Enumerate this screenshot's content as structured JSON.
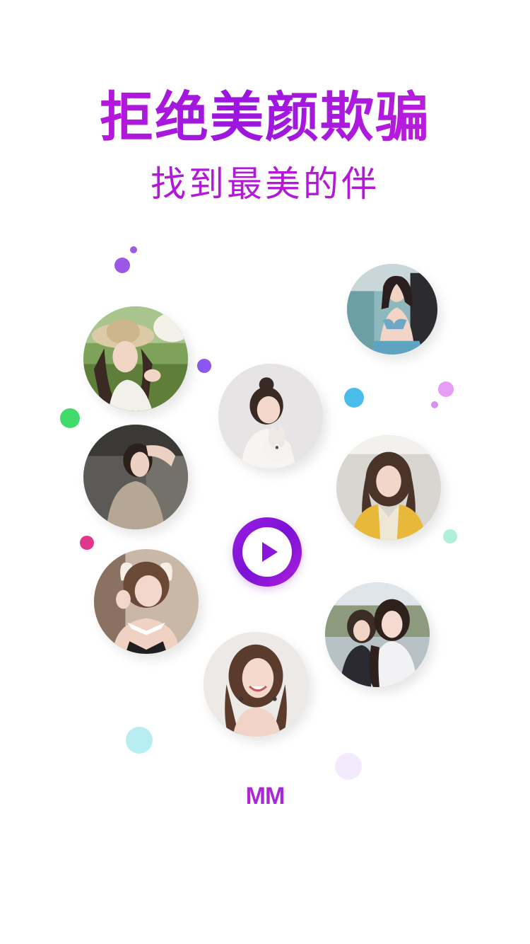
{
  "hero": {
    "title": "拒绝美颜欺骗",
    "subtitle": "找到最美的伴"
  },
  "brand": {
    "logo_text": "MM"
  },
  "colors": {
    "title_gradient": [
      "#c81ad6",
      "#9b16e0"
    ],
    "subtitle": "#b318d8",
    "play_button": "#8a16dc",
    "background": "#ffffff"
  },
  "avatars": [
    {
      "name": "avatar-sun-hat"
    },
    {
      "name": "avatar-bikini"
    },
    {
      "name": "avatar-bunny"
    },
    {
      "name": "avatar-car"
    },
    {
      "name": "avatar-yellow-jacket"
    },
    {
      "name": "avatar-wink"
    },
    {
      "name": "avatar-two-friends"
    },
    {
      "name": "avatar-smile"
    }
  ],
  "icons": {
    "play": "play-icon"
  }
}
